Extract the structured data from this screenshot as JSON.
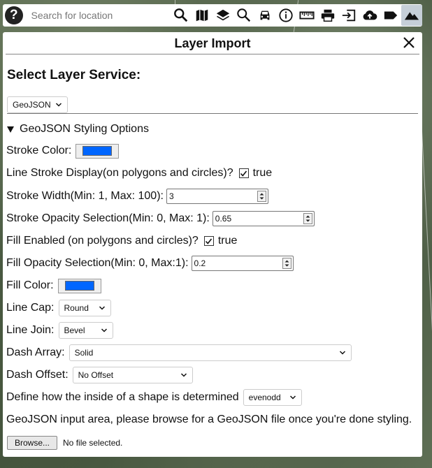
{
  "toolbar": {
    "help_icon": "question-circle-icon",
    "search_placeholder": "Search for location",
    "tools": [
      {
        "name": "search-icon"
      },
      {
        "name": "map-icon"
      },
      {
        "name": "layers-icon"
      },
      {
        "name": "search-icon"
      },
      {
        "name": "car-icon"
      },
      {
        "name": "info-icon"
      },
      {
        "name": "ruler-icon"
      },
      {
        "name": "print-icon"
      },
      {
        "name": "import-icon"
      },
      {
        "name": "cloud-upload-icon"
      },
      {
        "name": "tag-icon"
      },
      {
        "name": "terrain-icon",
        "active": true
      }
    ]
  },
  "panel": {
    "title": "Layer Import",
    "select_service_heading": "Select Layer Service:",
    "service_select_value": "GeoJSON",
    "styling_options_summary": "GeoJSON Styling Options",
    "stroke_color_label": "Stroke Color:",
    "stroke_color": "#0066ff",
    "line_stroke_display_label": "Line Stroke Display(on polygons and circles)?",
    "line_stroke_display_value": "true",
    "stroke_width_label": "Stroke Width(Min: 1, Max: 100):",
    "stroke_width_value": "3",
    "stroke_opacity_label": "Stroke Opacity Selection(Min: 0, Max: 1):",
    "stroke_opacity_value": "0.65",
    "fill_enabled_label": "Fill Enabled (on polygons and circles)?",
    "fill_enabled_value": "true",
    "fill_opacity_label": "Fill Opacity Selection(Min: 0, Max:1):",
    "fill_opacity_value": "0.2",
    "fill_color_label": "Fill Color:",
    "fill_color": "#0066ff",
    "line_cap_label": "Line Cap:",
    "line_cap_value": "Round",
    "line_join_label": "Line Join:",
    "line_join_value": "Bevel",
    "dash_array_label": "Dash Array:",
    "dash_array_value": "Solid",
    "dash_offset_label": "Dash Offset:",
    "dash_offset_value": "No Offset",
    "fill_rule_label": "Define how the inside of a shape is determined",
    "fill_rule_value": "evenodd",
    "input_area_text": "GeoJSON input area, please browse for a GeoJSON file once you're done styling.",
    "browse_label": "Browse...",
    "file_status": "No file selected."
  }
}
